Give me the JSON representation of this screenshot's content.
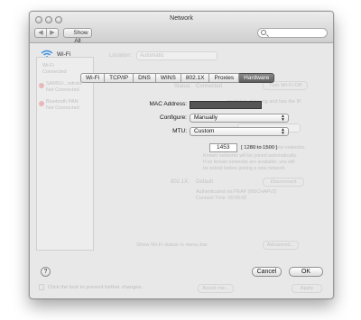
{
  "window": {
    "title": "Network"
  },
  "toolbar": {
    "back": "◀",
    "forward": "▶",
    "show_all": "Show All",
    "search_placeholder": ""
  },
  "header": {
    "wifi_label": "Wi-Fi",
    "location_label": "Location:",
    "location_value": "Automatic"
  },
  "sidebar": {
    "items": [
      {
        "name": "Wi-Fi",
        "status": "Connected"
      },
      {
        "name": "SAMSU...ndroid",
        "status": "Not Connected"
      },
      {
        "name": "Bluetooth PAN",
        "status": "Not Connected"
      }
    ]
  },
  "background": {
    "status_label": "Status:",
    "status_value": "Connected",
    "turn_off": "Turn Wi-Fi Off",
    "connected_desc": "...nected to minoang and has the IP",
    "network_name_label": "Network Name:",
    "ask_label": "Ask to join new networks",
    "ask_desc_1": "Known networks will be joined automatically.",
    "ask_desc_2": "If no known networks are available, you will",
    "ask_desc_3": "be asked before joining a new network.",
    "auth_label": "802.1X:",
    "auth_value": "Default",
    "disconnect": "Disconnect",
    "auth_desc_1": "Authenticated via PEAP (MSCHAPv2)",
    "auth_desc_2": "Connect Time: 00:00:00",
    "show_status": "Show Wi-Fi status in menu bar",
    "advanced": "Advanced...",
    "lock_text": "Click the lock to prevent further changes.",
    "assist": "Assist me...",
    "apply": "Apply"
  },
  "tabs": [
    "Wi-Fi",
    "TCP/IP",
    "DNS",
    "WINS",
    "802.1X",
    "Proxies",
    "Hardware"
  ],
  "active_tab": "Hardware",
  "hardware": {
    "mac_label": "MAC Address:",
    "configure_label": "Configure:",
    "configure_value": "Manually",
    "mtu_label": "MTU:",
    "mtu_value": "Custom",
    "mtu_number": "1453",
    "mtu_range": "[ 1280 to 1500 ]"
  },
  "buttons": {
    "help": "?",
    "cancel": "Cancel",
    "ok": "OK"
  }
}
